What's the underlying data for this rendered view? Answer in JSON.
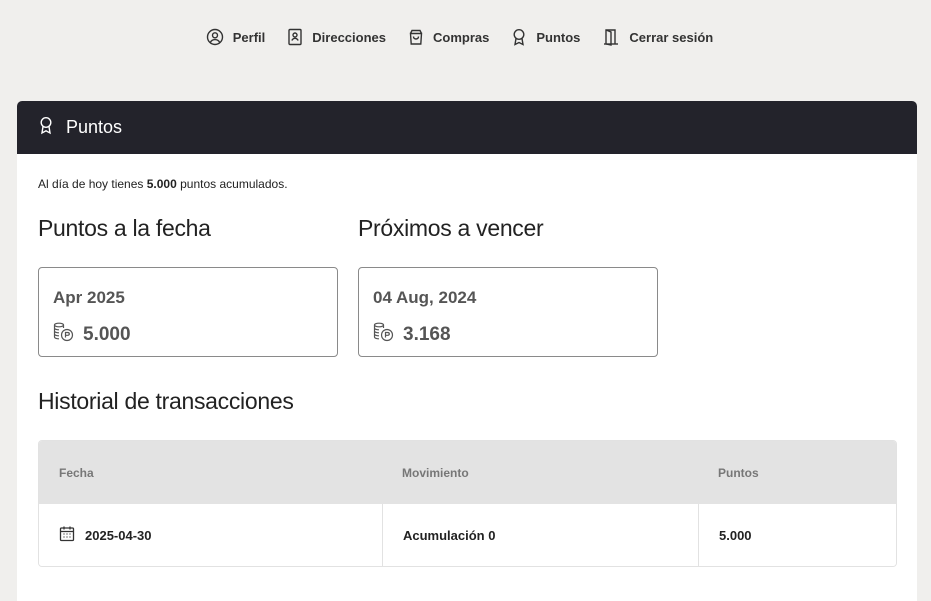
{
  "nav": {
    "items": [
      {
        "label": "Perfil",
        "icon": "user-circle-icon"
      },
      {
        "label": "Direcciones",
        "icon": "address-book-icon"
      },
      {
        "label": "Compras",
        "icon": "shopping-bag-icon"
      },
      {
        "label": "Puntos",
        "icon": "award-ribbon-icon"
      },
      {
        "label": "Cerrar sesión",
        "icon": "door-exit-icon"
      }
    ]
  },
  "card": {
    "title": "Puntos",
    "summary": {
      "prefix": "Al día de hoy tienes",
      "points": "5.000",
      "suffix": "puntos acumulados."
    }
  },
  "points_to_date": {
    "title": "Puntos a la fecha",
    "date": "Apr 2025",
    "value": "5.000"
  },
  "expiring": {
    "title": "Próximos a vencer",
    "date": "04 Aug, 2024",
    "value": "3.168"
  },
  "history": {
    "title": "Historial de transacciones",
    "columns": [
      "Fecha",
      "Movimiento",
      "Puntos"
    ],
    "rows": [
      {
        "date": "2025-04-30",
        "movement": "Acumulación 0",
        "points": "5.000"
      }
    ]
  },
  "colors": {
    "background": "#f0efed",
    "header_dark": "#23232b",
    "table_header": "#e3e3e3"
  }
}
